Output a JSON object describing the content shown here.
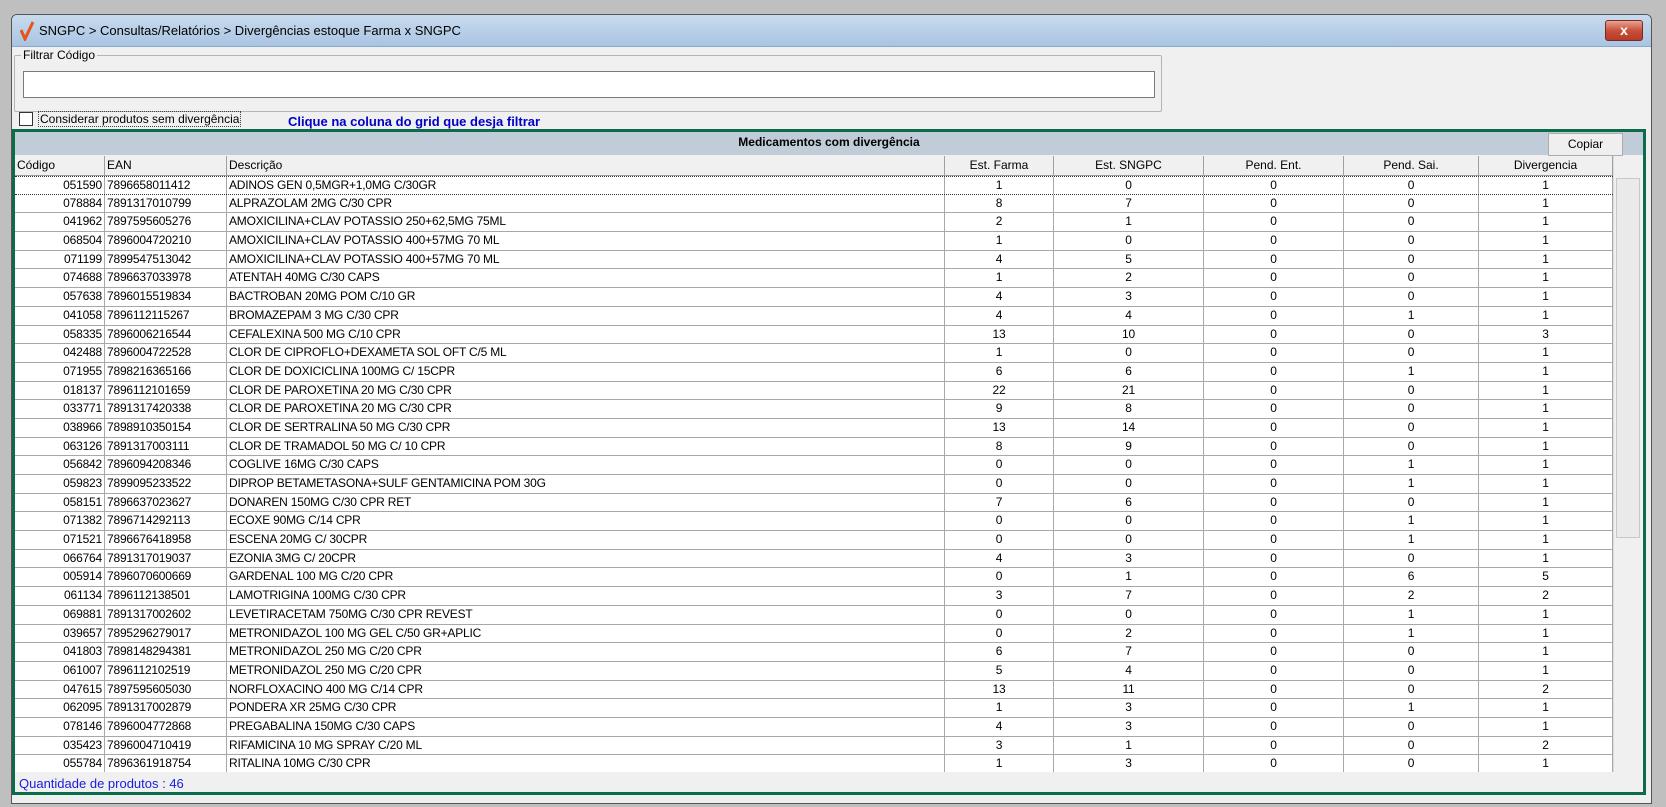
{
  "window": {
    "title": "SNGPC > Consultas/Relatórios > Divergências estoque Farma x SNGPC",
    "close_label": "x"
  },
  "filter": {
    "label": "Filtrar Código",
    "value": "",
    "placeholder": ""
  },
  "checkbox": {
    "label": "Considerar produtos sem divergência",
    "checked": false
  },
  "hint": "Clique na coluna do grid que desja filtrar",
  "panel": {
    "caption": "Medicamentos com divergência",
    "copy_label": "Copiar"
  },
  "grid": {
    "columns": [
      "Código",
      "EAN",
      "Descrição",
      "Est. Farma",
      "Est. SNGPC",
      "Pend. Ent.",
      "Pend. Sai.",
      "Divergencia"
    ],
    "rows": [
      [
        "051590",
        "7896658011412",
        "ADINOS GEN 0,5MGR+1,0MG C/30GR",
        "1",
        "0",
        "0",
        "0",
        "1"
      ],
      [
        "078884",
        "7891317010799",
        "ALPRAZOLAM 2MG C/30 CPR",
        "8",
        "7",
        "0",
        "0",
        "1"
      ],
      [
        "041962",
        "7897595605276",
        "AMOXICILINA+CLAV POTASSIO 250+62,5MG 75ML",
        "2",
        "1",
        "0",
        "0",
        "1"
      ],
      [
        "068504",
        "7896004720210",
        "AMOXICILINA+CLAV POTASSIO 400+57MG 70 ML",
        "1",
        "0",
        "0",
        "0",
        "1"
      ],
      [
        "071199",
        "7899547513042",
        "AMOXICILINA+CLAV POTASSIO 400+57MG 70 ML",
        "4",
        "5",
        "0",
        "0",
        "1"
      ],
      [
        "074688",
        "7896637033978",
        "ATENTAH 40MG C/30 CAPS",
        "1",
        "2",
        "0",
        "0",
        "1"
      ],
      [
        "057638",
        "7896015519834",
        "BACTROBAN 20MG POM C/10 GR",
        "4",
        "3",
        "0",
        "0",
        "1"
      ],
      [
        "041058",
        "7896112115267",
        "BROMAZEPAM 3 MG C/30 CPR",
        "4",
        "4",
        "0",
        "1",
        "1"
      ],
      [
        "058335",
        "7896006216544",
        "CEFALEXINA 500 MG C/10 CPR",
        "13",
        "10",
        "0",
        "0",
        "3"
      ],
      [
        "042488",
        "7896004722528",
        "CLOR DE CIPROFLO+DEXAMETA SOL OFT C/5 ML",
        "1",
        "0",
        "0",
        "0",
        "1"
      ],
      [
        "071955",
        "7898216365166",
        "CLOR DE DOXICICLINA 100MG C/ 15CPR",
        "6",
        "6",
        "0",
        "1",
        "1"
      ],
      [
        "018137",
        "7896112101659",
        "CLOR DE PAROXETINA 20 MG C/30 CPR",
        "22",
        "21",
        "0",
        "0",
        "1"
      ],
      [
        "033771",
        "7891317420338",
        "CLOR DE PAROXETINA 20 MG C/30 CPR",
        "9",
        "8",
        "0",
        "0",
        "1"
      ],
      [
        "038966",
        "7898910350154",
        "CLOR DE SERTRALINA 50 MG C/30 CPR",
        "13",
        "14",
        "0",
        "0",
        "1"
      ],
      [
        "063126",
        "7891317003111",
        "CLOR DE TRAMADOL 50 MG C/ 10 CPR",
        "8",
        "9",
        "0",
        "0",
        "1"
      ],
      [
        "056842",
        "7896094208346",
        "COGLIVE 16MG C/30 CAPS",
        "0",
        "0",
        "0",
        "1",
        "1"
      ],
      [
        "059823",
        "7899095233522",
        "DIPROP BETAMETASONA+SULF GENTAMICINA POM 30G",
        "0",
        "0",
        "0",
        "1",
        "1"
      ],
      [
        "058151",
        "7896637023627",
        "DONAREN 150MG C/30 CPR RET",
        "7",
        "6",
        "0",
        "0",
        "1"
      ],
      [
        "071382",
        "7896714292113",
        "ECOXE 90MG C/14 CPR",
        "0",
        "0",
        "0",
        "1",
        "1"
      ],
      [
        "071521",
        "7896676418958",
        "ESCENA 20MG C/ 30CPR",
        "0",
        "0",
        "0",
        "1",
        "1"
      ],
      [
        "066764",
        "7891317019037",
        "EZONIA 3MG C/ 20CPR",
        "4",
        "3",
        "0",
        "0",
        "1"
      ],
      [
        "005914",
        "7896070600669",
        "GARDENAL 100 MG C/20 CPR",
        "0",
        "1",
        "0",
        "6",
        "5"
      ],
      [
        "061134",
        "7896112138501",
        "LAMOTRIGINA 100MG C/30 CPR",
        "3",
        "7",
        "0",
        "2",
        "2"
      ],
      [
        "069881",
        "7891317002602",
        "LEVETIRACETAM 750MG C/30 CPR REVEST",
        "0",
        "0",
        "0",
        "1",
        "1"
      ],
      [
        "039657",
        "7895296279017",
        "METRONIDAZOL 100 MG GEL C/50 GR+APLIC",
        "0",
        "2",
        "0",
        "1",
        "1"
      ],
      [
        "041803",
        "7898148294381",
        "METRONIDAZOL 250 MG C/20 CPR",
        "6",
        "7",
        "0",
        "0",
        "1"
      ],
      [
        "061007",
        "7896112102519",
        "METRONIDAZOL 250 MG C/20 CPR",
        "5",
        "4",
        "0",
        "0",
        "1"
      ],
      [
        "047615",
        "7897595605030",
        "NORFLOXACINO 400 MG C/14 CPR",
        "13",
        "11",
        "0",
        "0",
        "2"
      ],
      [
        "062095",
        "7891317002879",
        "PONDERA XR 25MG C/30 CPR",
        "1",
        "3",
        "0",
        "1",
        "1"
      ],
      [
        "078146",
        "7896004772868",
        "PREGABALINA 150MG C/30 CAPS",
        "4",
        "3",
        "0",
        "0",
        "1"
      ],
      [
        "035423",
        "7896004710419",
        "RIFAMICINA 10 MG SPRAY C/20 ML",
        "3",
        "1",
        "0",
        "0",
        "2"
      ],
      [
        "055784",
        "7896361918754",
        "RITALINA 10MG C/30 CPR",
        "1",
        "3",
        "0",
        "0",
        "1"
      ]
    ]
  },
  "footer": "Quantidade de produtos : 46",
  "colors": {
    "accent_green": "#0b6b4a",
    "hint_blue": "#0000c8",
    "footer_blue": "#1a1ae0"
  }
}
